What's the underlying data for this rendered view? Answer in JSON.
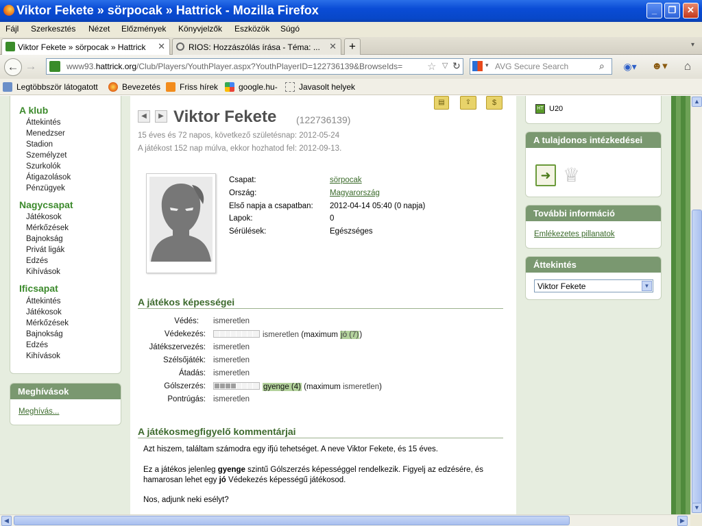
{
  "window": {
    "title": "Viktor Fekete » sörpocak » Hattrick - Mozilla Firefox"
  },
  "menu": [
    "Fájl",
    "Szerkesztés",
    "Nézet",
    "Előzmények",
    "Könyvjelzők",
    "Eszközök",
    "Súgó"
  ],
  "tabs": [
    {
      "label": "Viktor Fekete » sörpocak » Hattrick",
      "active": true
    },
    {
      "label": "RIOS: Hozzászólás írása - Téma: ...",
      "active": false
    }
  ],
  "navbar": {
    "url_prefix": "www93.",
    "url_domain": "hattrick.org",
    "url_path": "/Club/Players/YouthPlayer.aspx?YouthPlayerID=122736139&BrowseIds=",
    "search_placeholder": "AVG Secure Search"
  },
  "bookmarks": [
    "Legtöbbször látogatott",
    "Bevezetés",
    "Friss hírek",
    "google.hu-",
    "Javasolt helyek"
  ],
  "left_nav": {
    "sections": [
      {
        "title": "A klub",
        "items": [
          "Áttekintés",
          "Menedzser",
          "Stadion",
          "Személyzet",
          "Szurkolók",
          "Átigazolások",
          "Pénzügyek"
        ]
      },
      {
        "title": "Nagycsapat",
        "items": [
          "Játékosok",
          "Mérkőzések",
          "Bajnokság",
          "Privát ligák",
          "Edzés",
          "Kihívások"
        ]
      },
      {
        "title": "Ificsapat",
        "items": [
          "Áttekintés",
          "Játékosok",
          "Mérkőzések",
          "Bajnokság",
          "Edzés",
          "Kihívások"
        ]
      }
    ],
    "invites": {
      "title": "Meghívások",
      "link": "Meghívás..."
    }
  },
  "player": {
    "name": "Viktor Fekete",
    "id": "(122736139)",
    "age_line": "15 éves és 72 napos, következő születésnap: 2012-05-24",
    "promote_line": "A játékost 152 nap múlva, ekkor hozhatod fel: 2012-09-13.",
    "info": [
      {
        "label": "Csapat:",
        "value": "sörpocak",
        "link": true
      },
      {
        "label": "Ország:",
        "value": "Magyarország",
        "link": true
      },
      {
        "label": "Első napja a csapatban:",
        "value": "2012-04-14 05:40 (0 napja)",
        "link": false
      },
      {
        "label": "Lapok:",
        "value": "0",
        "link": false
      },
      {
        "label": "Sérülések:",
        "value": "Egészséges",
        "link": false
      }
    ]
  },
  "skills": {
    "title": "A játékos képességei",
    "rows": [
      {
        "label": "Védés:",
        "value": "ismeretlen"
      },
      {
        "label": "Védekezés:",
        "value": "ismeretlen",
        "bar_level": 0,
        "max_prefix": "(maximum ",
        "max_value": "jó (7)",
        "max_suffix": ")"
      },
      {
        "label": "Játékszervezés:",
        "value": "ismeretlen"
      },
      {
        "label": "Szélsőjáték:",
        "value": "ismeretlen"
      },
      {
        "label": "Átadás:",
        "value": "ismeretlen"
      },
      {
        "label": "Gólszerzés:",
        "value": "gyenge (4)",
        "bar_level": 4,
        "max_prefix": "(maximum ",
        "max_value": "ismeretlen",
        "max_suffix": ")"
      },
      {
        "label": "Pontrúgás:",
        "value": "ismeretlen"
      }
    ]
  },
  "scout": {
    "title": "A játékosmegfigyelő kommentárjai",
    "p1": "Azt hiszem, találtam számodra egy ifjú tehetséget. A neve Viktor Fekete, és 15 éves.",
    "p2_a": "Ez a játékos jelenleg ",
    "p2_b": "gyenge",
    "p2_c": " szintű Gólszerzés képességgel rendelkezik. Figyelj az edzésére, és hamarosan lehet egy ",
    "p2_d": "jó",
    "p2_e": " Védekezés képességű játékosod.",
    "p3": "Nos, adjunk neki esélyt?"
  },
  "right": {
    "u20": "U20",
    "owner": {
      "title": "A tulajdonos intézkedései"
    },
    "more": {
      "title": "További információ",
      "link": "Emlékezetes pillanatok"
    },
    "overview": {
      "title": "Áttekintés",
      "selected": "Viktor Fekete"
    }
  },
  "colors": {
    "accent_green": "#3c8a2c",
    "box_header": "#7a9870",
    "title_blue": "#0a4cd6"
  }
}
